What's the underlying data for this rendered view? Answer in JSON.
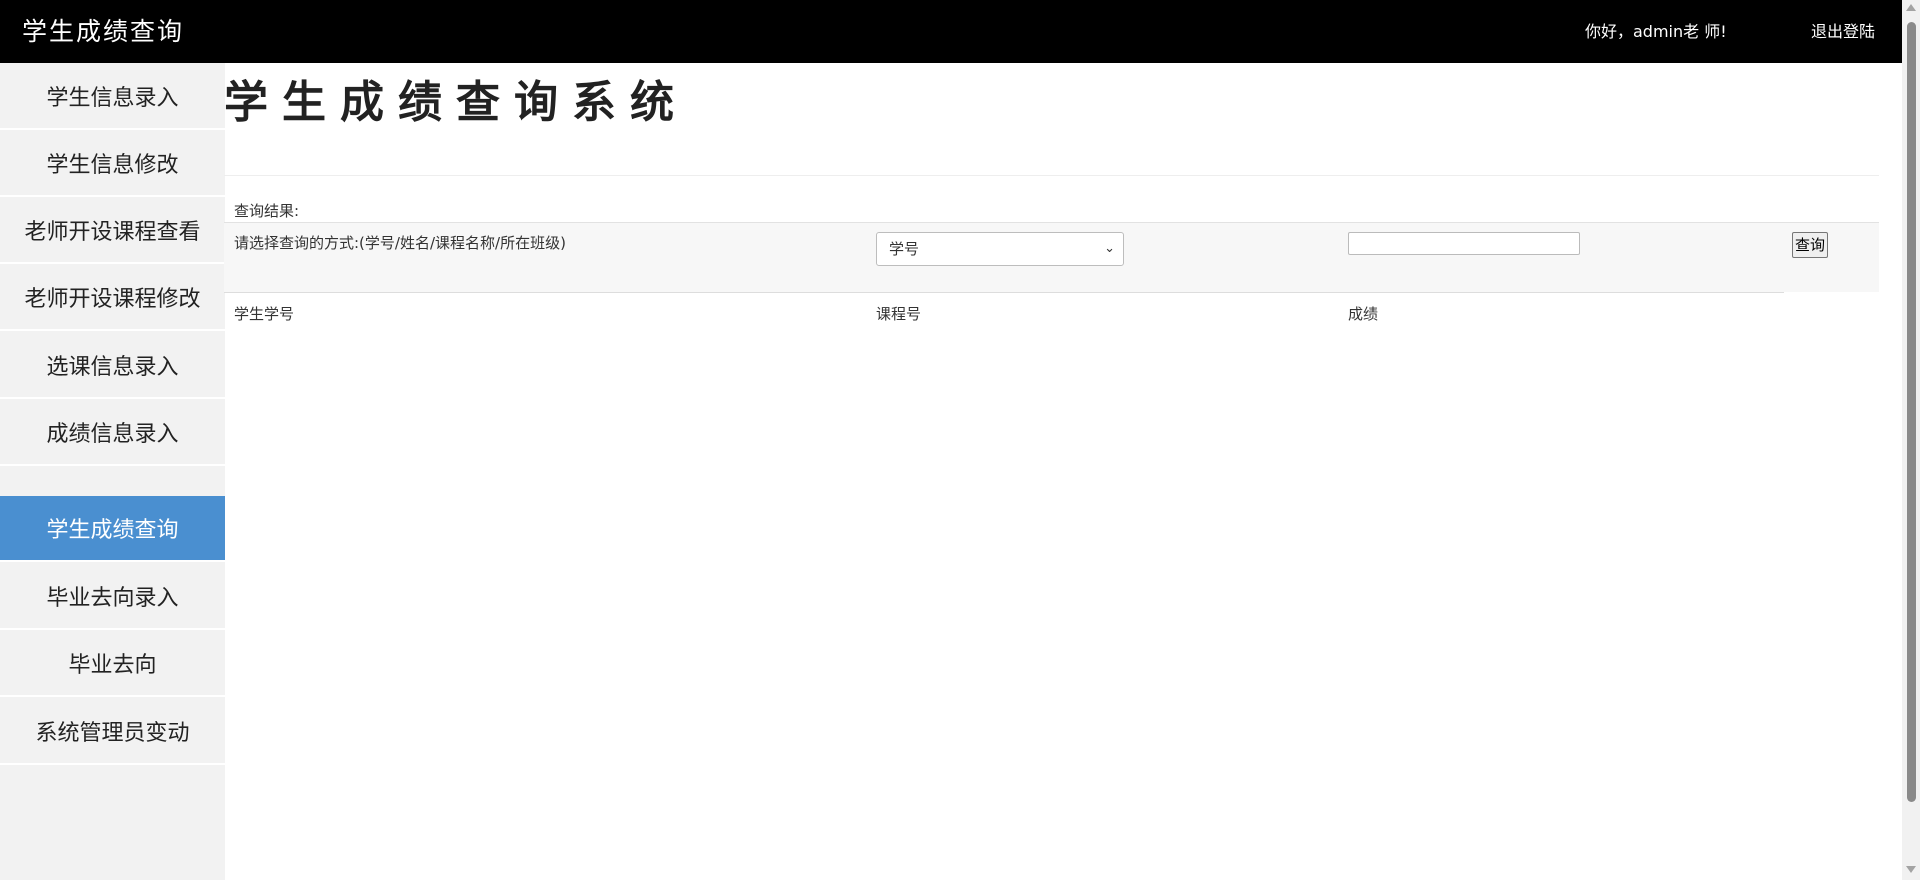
{
  "header": {
    "app_title": "学生成绩查询",
    "greeting": "你好，admin老 师!",
    "logout_label": "退出登陆"
  },
  "sidebar": {
    "items": [
      {
        "label": "学生信息录入",
        "active": false
      },
      {
        "label": "学生信息修改",
        "active": false
      },
      {
        "label": "老师开设课程查看",
        "active": false
      },
      {
        "label": "老师开设课程修改",
        "active": false
      },
      {
        "label": "选课信息录入",
        "active": false
      },
      {
        "label": "成绩信息录入",
        "active": false
      },
      {
        "label": "学生成绩查询",
        "active": true
      },
      {
        "label": "毕业去向录入",
        "active": false
      },
      {
        "label": "毕业去向",
        "active": false
      },
      {
        "label": "系统管理员变动",
        "active": false
      }
    ]
  },
  "main": {
    "page_heading": "学生成绩查询系统",
    "result_label": "查询结果:",
    "query_prompt": "请选择查询的方式:(学号/姓名/课程名称/所在班级)",
    "query_type_selected": "学号",
    "query_input_value": "",
    "query_button_label": "查询",
    "columns": [
      "学生学号",
      "课程号",
      "成绩"
    ]
  },
  "colors": {
    "topbar_bg": "#000000",
    "sidebar_bg": "#f2f2f2",
    "active_nav_bg": "#4a8fd0",
    "active_nav_text": "#ffffff"
  }
}
